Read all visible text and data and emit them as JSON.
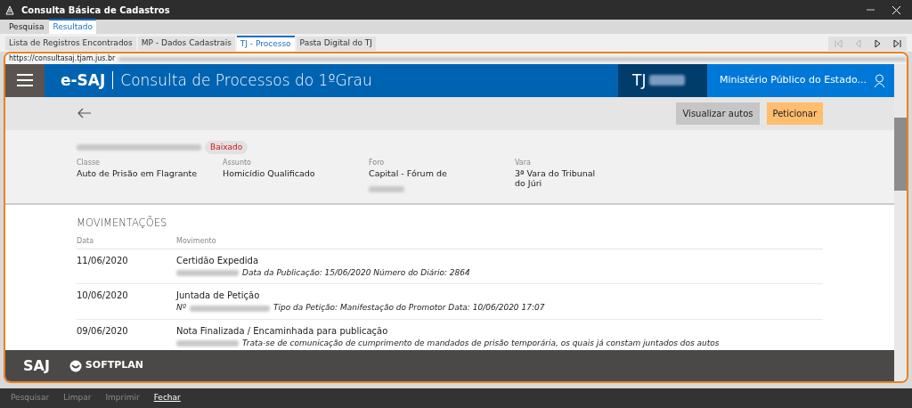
{
  "window": {
    "title": "Consulta Básica de Cadastros"
  },
  "main_tabs": [
    {
      "label": "Pesquisa",
      "selected": false
    },
    {
      "label": "Resultado",
      "selected": true
    }
  ],
  "sub_tabs": [
    {
      "label": "Lista de Registros Encontrados",
      "selected": false
    },
    {
      "label": "MP - Dados Cadastrais",
      "selected": false
    },
    {
      "label": "TJ - Processo",
      "selected": true
    },
    {
      "label": "Pasta Digital do TJ",
      "selected": false
    }
  ],
  "record_nav": [
    {
      "kind": "first",
      "disabled": true
    },
    {
      "kind": "previous",
      "disabled": true
    },
    {
      "kind": "next",
      "disabled": false
    },
    {
      "kind": "last",
      "disabled": false
    }
  ],
  "browser": {
    "url": "https://consultasaj.tjam.jus.br"
  },
  "site": {
    "brand": "e-SAJ",
    "title": "Consulta de Processos do 1ºGrau",
    "court": "TJ",
    "user": "Ministério Público do Estado..."
  },
  "actions": [
    {
      "label": "Visualizar autos",
      "kind": "secondary"
    },
    {
      "label": "Peticionar",
      "kind": "primary"
    }
  ],
  "process": {
    "status": "Baixado",
    "fields": [
      {
        "label": "Classe",
        "value": "Auto de Prisão em Flagrante"
      },
      {
        "label": "Assunto",
        "value": "Homicídio Qualificado"
      },
      {
        "label": "Foro",
        "value": "Capital - Fórum de"
      },
      {
        "label": "Vara",
        "value": "3ª Vara do Tribunal do Júri"
      }
    ]
  },
  "movements": {
    "heading": "MOVIMENTAÇÕES",
    "columns": [
      "Data",
      "Movimento"
    ],
    "rows": [
      {
        "date": "11/06/2020",
        "title": "Certidão Expedida",
        "detail": "Data da Publicação: 15/06/2020 Número do Diário: 2864"
      },
      {
        "date": "10/06/2020",
        "title": "Juntada de Petição",
        "detail_prefix": "Nº",
        "detail": "Tipo da Petição: Manifestação do Promotor Data: 10/06/2020 17:07"
      },
      {
        "date": "09/06/2020",
        "title": "Nota Finalizada / Encaminhada para publicação",
        "detail": "Trata-se de comunicação de cumprimento de mandados de prisão temporária, os quais já constam juntados dos autos"
      }
    ]
  },
  "footer": {
    "logos": [
      "SAJ",
      "SOFTPLAN"
    ]
  },
  "bottom_buttons": [
    {
      "label": "Pesquisar",
      "disabled": true
    },
    {
      "label": "Limpar",
      "disabled": true
    },
    {
      "label": "Imprimir",
      "disabled": true
    },
    {
      "label": "Fechar",
      "disabled": false
    }
  ]
}
